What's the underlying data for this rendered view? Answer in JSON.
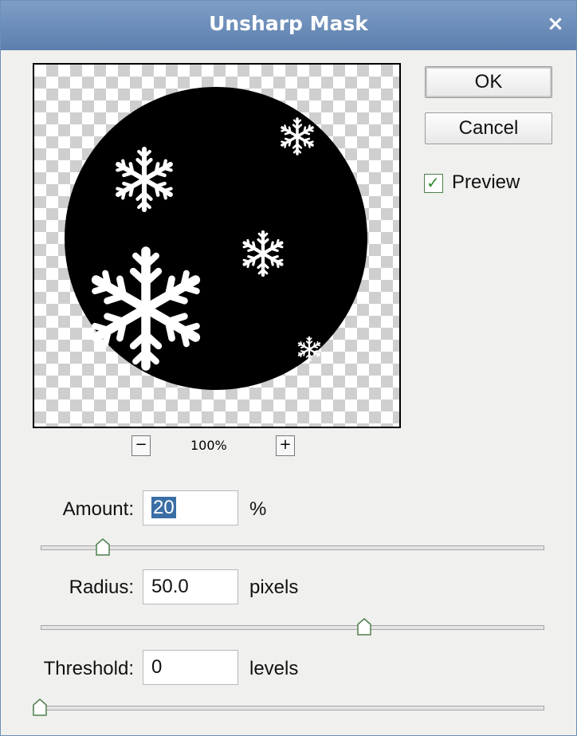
{
  "window": {
    "title": "Unsharp Mask",
    "close_label": "×"
  },
  "preview": {
    "zoom_minus": "−",
    "zoom_plus": "+",
    "zoom_level": "100%"
  },
  "buttons": {
    "ok": "OK",
    "cancel": "Cancel"
  },
  "preview_checkbox": {
    "label": "Preview",
    "checked": true,
    "mark": "✓"
  },
  "amount": {
    "label": "Amount:",
    "value": "20",
    "unit": "%",
    "slider_fraction": 0.11
  },
  "radius": {
    "label": "Radius:",
    "value": "50.0",
    "unit": "pixels",
    "slider_fraction": 0.63
  },
  "threshold": {
    "label": "Threshold:",
    "value": "0",
    "unit": "levels",
    "slider_fraction": 0.0
  },
  "colors": {
    "titlebar": "#6a8cb9",
    "dialog_bg": "#f0f0ee",
    "selection": "#3a6ea5",
    "checkmark": "#2e8b2e"
  }
}
